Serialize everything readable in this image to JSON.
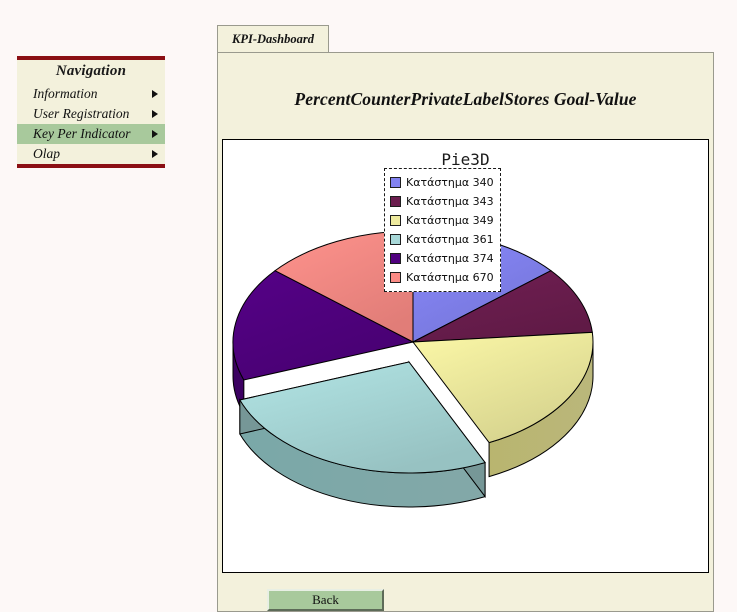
{
  "colors": {
    "panel_bg": "#f3f1dc",
    "page_bg": "#fdf8f7",
    "menu_border": "#8b0f14",
    "menu_selected": "#a8c99c",
    "button_face": "#a8c99c",
    "chart_bg": "#ffffff"
  },
  "sidebar": {
    "title": "Navigation",
    "items": [
      {
        "label": "Information",
        "selected": false,
        "arrow": "triangle-right-icon"
      },
      {
        "label": "User Registration",
        "selected": false,
        "arrow": "triangle-right-icon"
      },
      {
        "label": "Key Per Indicator",
        "selected": true,
        "arrow": "triangle-right-icon"
      },
      {
        "label": "Olap",
        "selected": false,
        "arrow": "triangle-right-icon"
      }
    ]
  },
  "tabs": [
    {
      "label": "KPI-Dashboard",
      "active": true
    }
  ],
  "main": {
    "title": "PercentCounterPrivateLabelStores Goal-Value",
    "back_label": "Back"
  },
  "chart_data": {
    "type": "pie",
    "title": "Pie3D",
    "xlabel": "",
    "ylabel": "",
    "grid": false,
    "legend_position": "right",
    "three_d": true,
    "labels": [
      "Κατάστημα 340",
      "Κατάστημα 343",
      "Κατάστημα 349",
      "Κατάστημα 361",
      "Κατάστημα 374",
      "Κατάστημα 670"
    ],
    "values": [
      13.9,
      9.7,
      19.4,
      26.4,
      16.7,
      13.9
    ],
    "start_angles": [
      0,
      50,
      85,
      155,
      250,
      310
    ],
    "end_angles": [
      50,
      85,
      155,
      250,
      310,
      360
    ],
    "colors": [
      "#8282f0",
      "#6b1d4e",
      "#eeea9e",
      "#a8d8d8",
      "#50017f",
      "#fa8b85"
    ],
    "side_colors": [
      "#5a5ac0",
      "#4a1436",
      "#b9b56f",
      "#7aa8a8",
      "#3a0160",
      "#c06560"
    ],
    "exploded_slice": "Κατάστημα 361"
  }
}
